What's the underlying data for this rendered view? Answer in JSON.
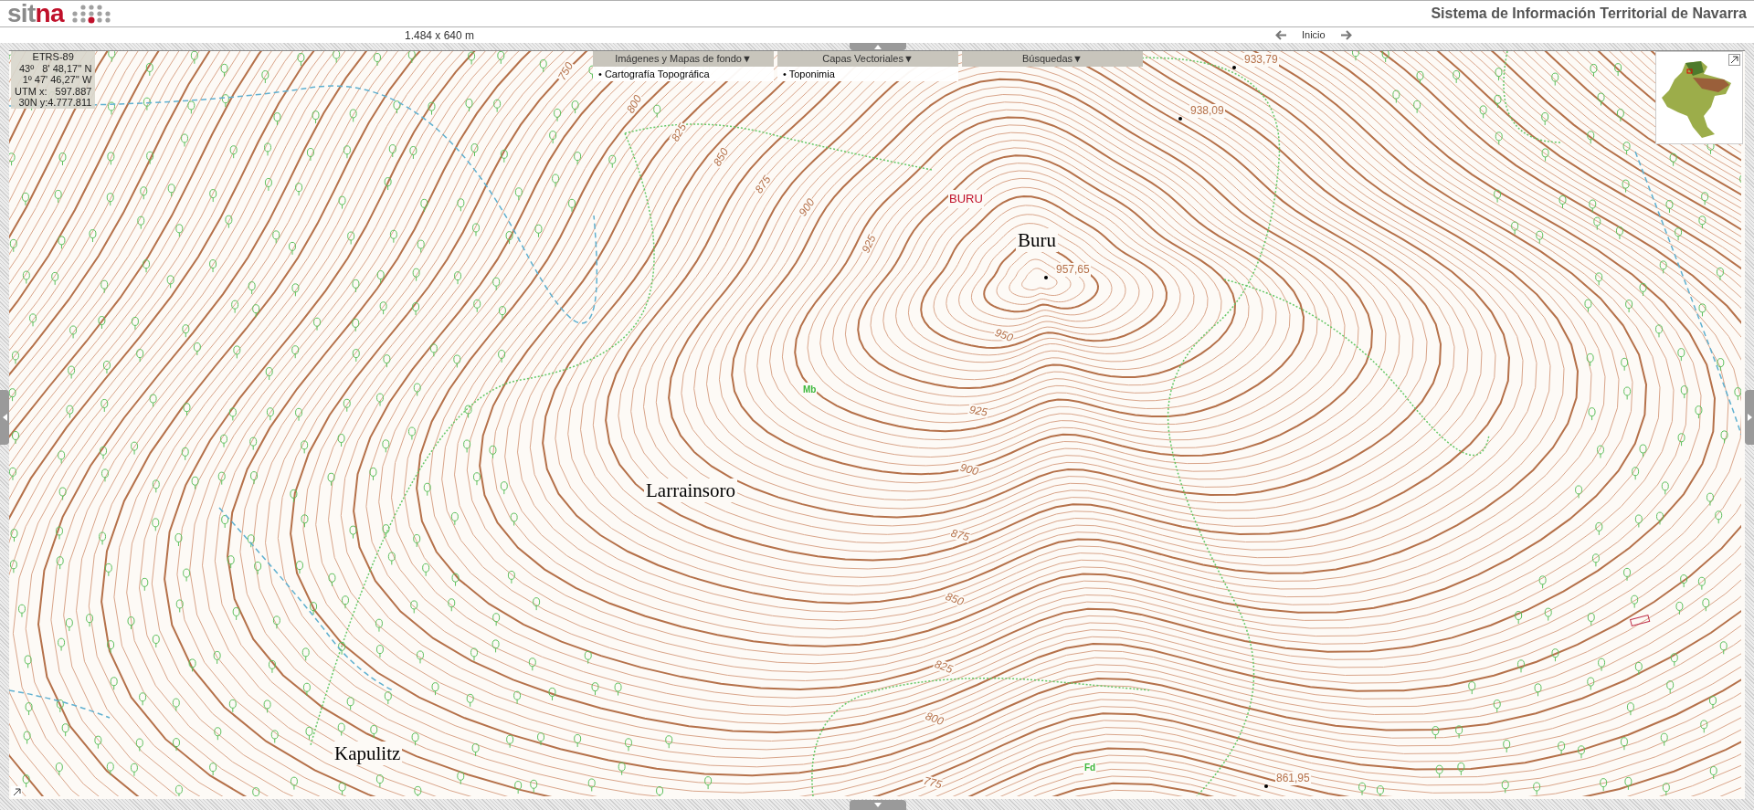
{
  "header": {
    "logo": {
      "part_1": "sit",
      "part_2": "na"
    },
    "title": "Sistema de Información Territorial de Navarra"
  },
  "toolbar": {
    "scale": "1.484 x 640 m",
    "nav_label": "Inicio"
  },
  "coordinates": {
    "datum": "ETRS-89",
    "lines": [
      "43º   8' 48,17'' N",
      "1º 47' 46,27'' W",
      "UTM x:   597.887",
      "30N y:4.777.811"
    ]
  },
  "menus": [
    {
      "label": "Imágenes y Mapas de fondo▼",
      "items": [
        "• Cartografía Topográfica"
      ]
    },
    {
      "label": "Capas Vectoriales▼",
      "items": [
        "• Toponimia"
      ]
    },
    {
      "label": "Búsquedas▼"
    }
  ],
  "map": {
    "labels": [
      {
        "text": "BURU",
        "kind": "toponym"
      },
      {
        "text": "Buru",
        "kind": "place"
      },
      {
        "text": "957,65",
        "kind": "elevation"
      },
      {
        "text": "Larrainsoro",
        "kind": "place"
      },
      {
        "text": "Kapulitz",
        "kind": "place"
      },
      {
        "text": "933,79",
        "kind": "elevation"
      },
      {
        "text": "938,09",
        "kind": "elevation"
      },
      {
        "text": "861,95",
        "kind": "elevation"
      },
      {
        "text": "Mb",
        "kind": "vegetation"
      },
      {
        "text": "Fd",
        "kind": "vegetation"
      },
      {
        "text": "950",
        "kind": "contour"
      },
      {
        "text": "925",
        "kind": "contour"
      },
      {
        "text": "900",
        "kind": "contour"
      },
      {
        "text": "875",
        "kind": "contour"
      },
      {
        "text": "850",
        "kind": "contour"
      },
      {
        "text": "825",
        "kind": "contour"
      },
      {
        "text": "800",
        "kind": "contour"
      },
      {
        "text": "775",
        "kind": "contour"
      },
      {
        "text": "925",
        "kind": "contour"
      },
      {
        "text": "900",
        "kind": "contour"
      },
      {
        "text": "875",
        "kind": "contour"
      },
      {
        "text": "850",
        "kind": "contour"
      },
      {
        "text": "825",
        "kind": "contour"
      },
      {
        "text": "800",
        "kind": "contour"
      },
      {
        "text": "750",
        "kind": "contour"
      }
    ]
  }
}
